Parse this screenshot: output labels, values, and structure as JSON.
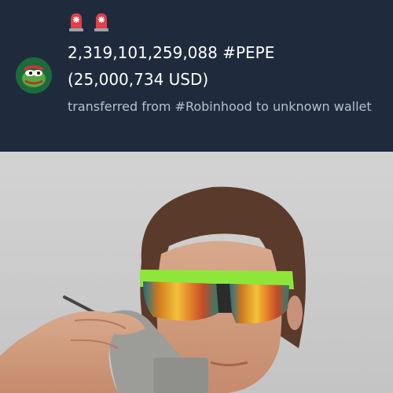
{
  "post": {
    "alert_icons": [
      "police-light-icon",
      "police-light-icon"
    ],
    "amount_line": "2,319,101,259,088 #PEPE",
    "usd_line": "(25,000,734 USD)",
    "description": "transferred from #Robinhood to unknown wallet",
    "colors": {
      "background": "#1f2b3c",
      "text": "#ffffff",
      "subtext": "#b7c0cb",
      "alert": "#e0404a"
    }
  },
  "attachment": {
    "image": "man-with-sport-sunglasses-and-brick-phone"
  }
}
